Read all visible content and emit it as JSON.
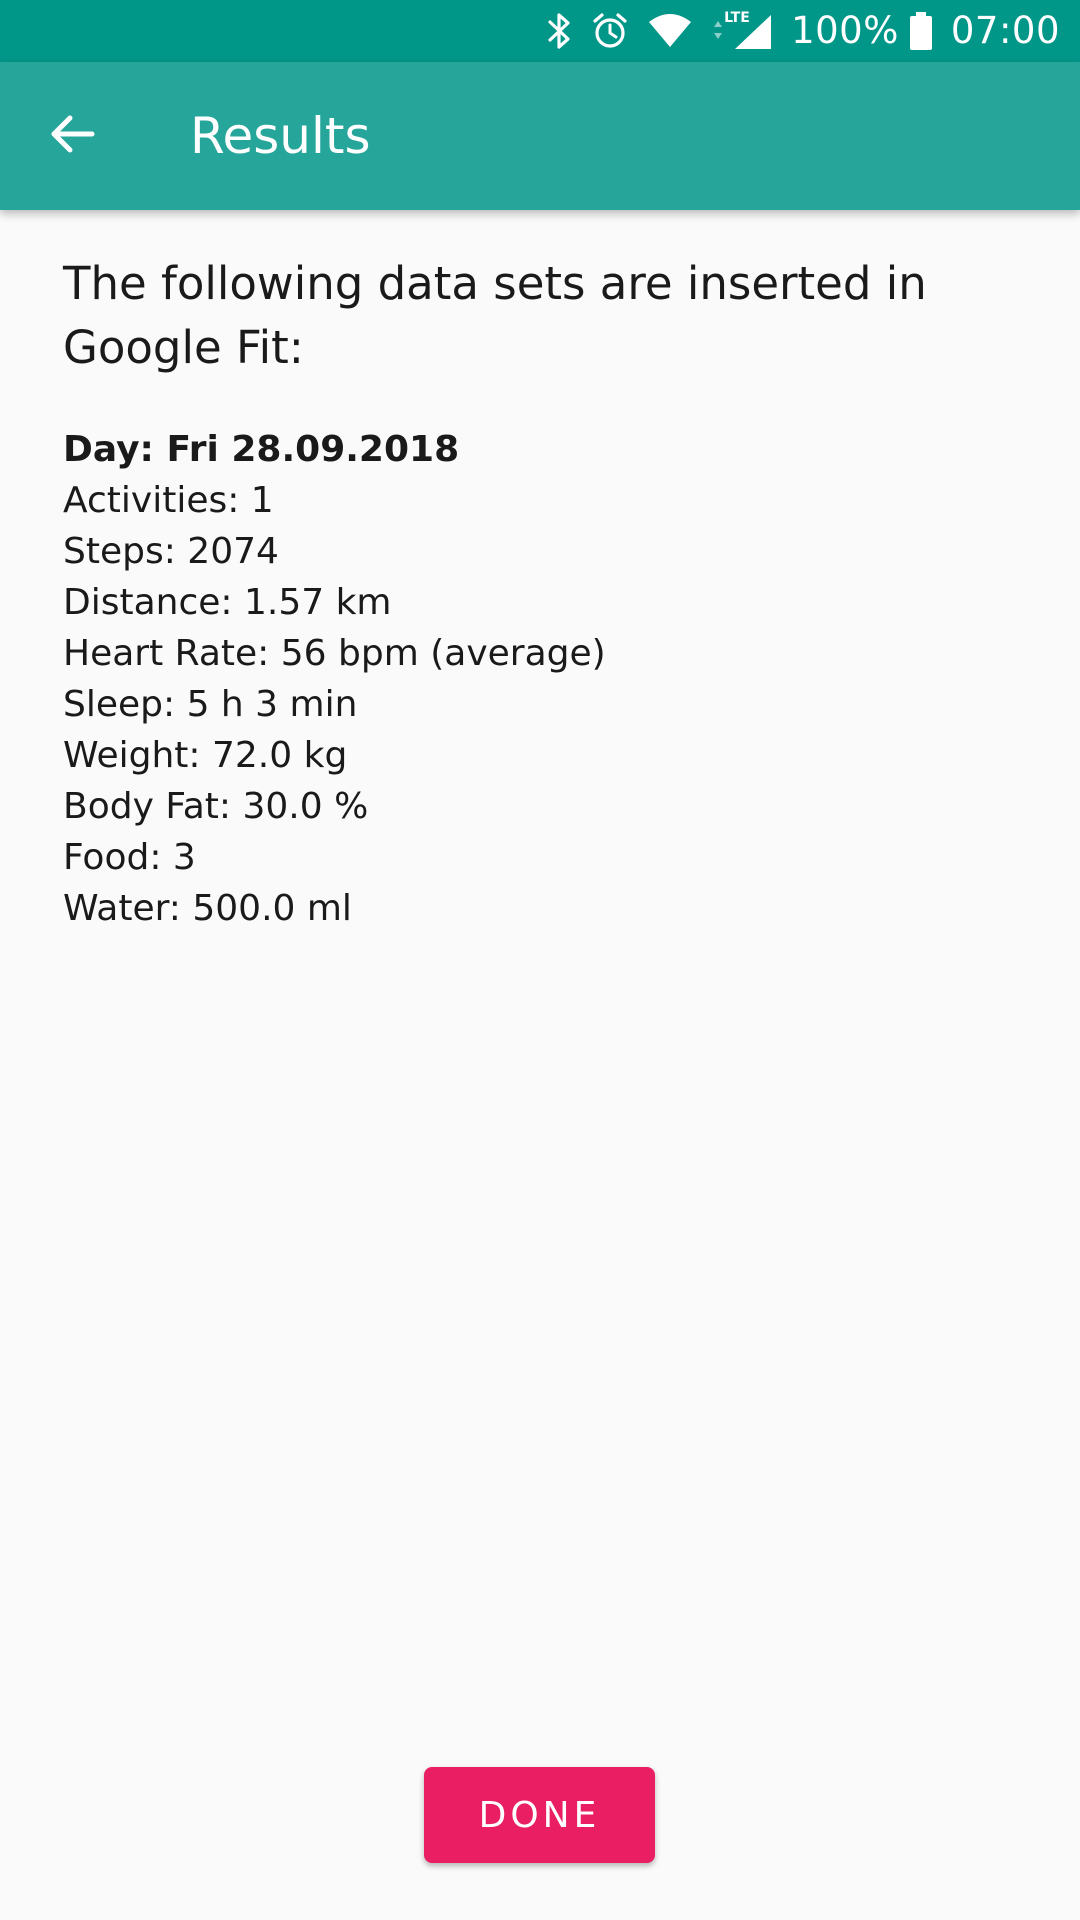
{
  "status_bar": {
    "battery": "100%",
    "time": "07:00",
    "network_label": "LTE",
    "icons": [
      "bluetooth-icon",
      "alarm-icon",
      "wifi-icon",
      "cell-signal-icon",
      "battery-icon"
    ]
  },
  "app_bar": {
    "title": "Results",
    "back_icon": "arrow-left-icon"
  },
  "content": {
    "intro": "The following data sets are inserted in Google Fit:",
    "day": "Day: Fri 28.09.2018",
    "items": [
      "Activities: 1",
      "Steps: 2074",
      "Distance: 1.57 km",
      "Heart Rate: 56 bpm (average)",
      "Sleep: 5 h 3 min",
      "Weight: 72.0 kg",
      "Body Fat: 30.0 %",
      "Food: 3",
      "Water: 500.0 ml"
    ]
  },
  "actions": {
    "done_label": "DONE"
  },
  "colors": {
    "status_bar": "#009688",
    "app_bar": "#26a69a",
    "background": "#fafafa",
    "accent": "#e91e63"
  }
}
